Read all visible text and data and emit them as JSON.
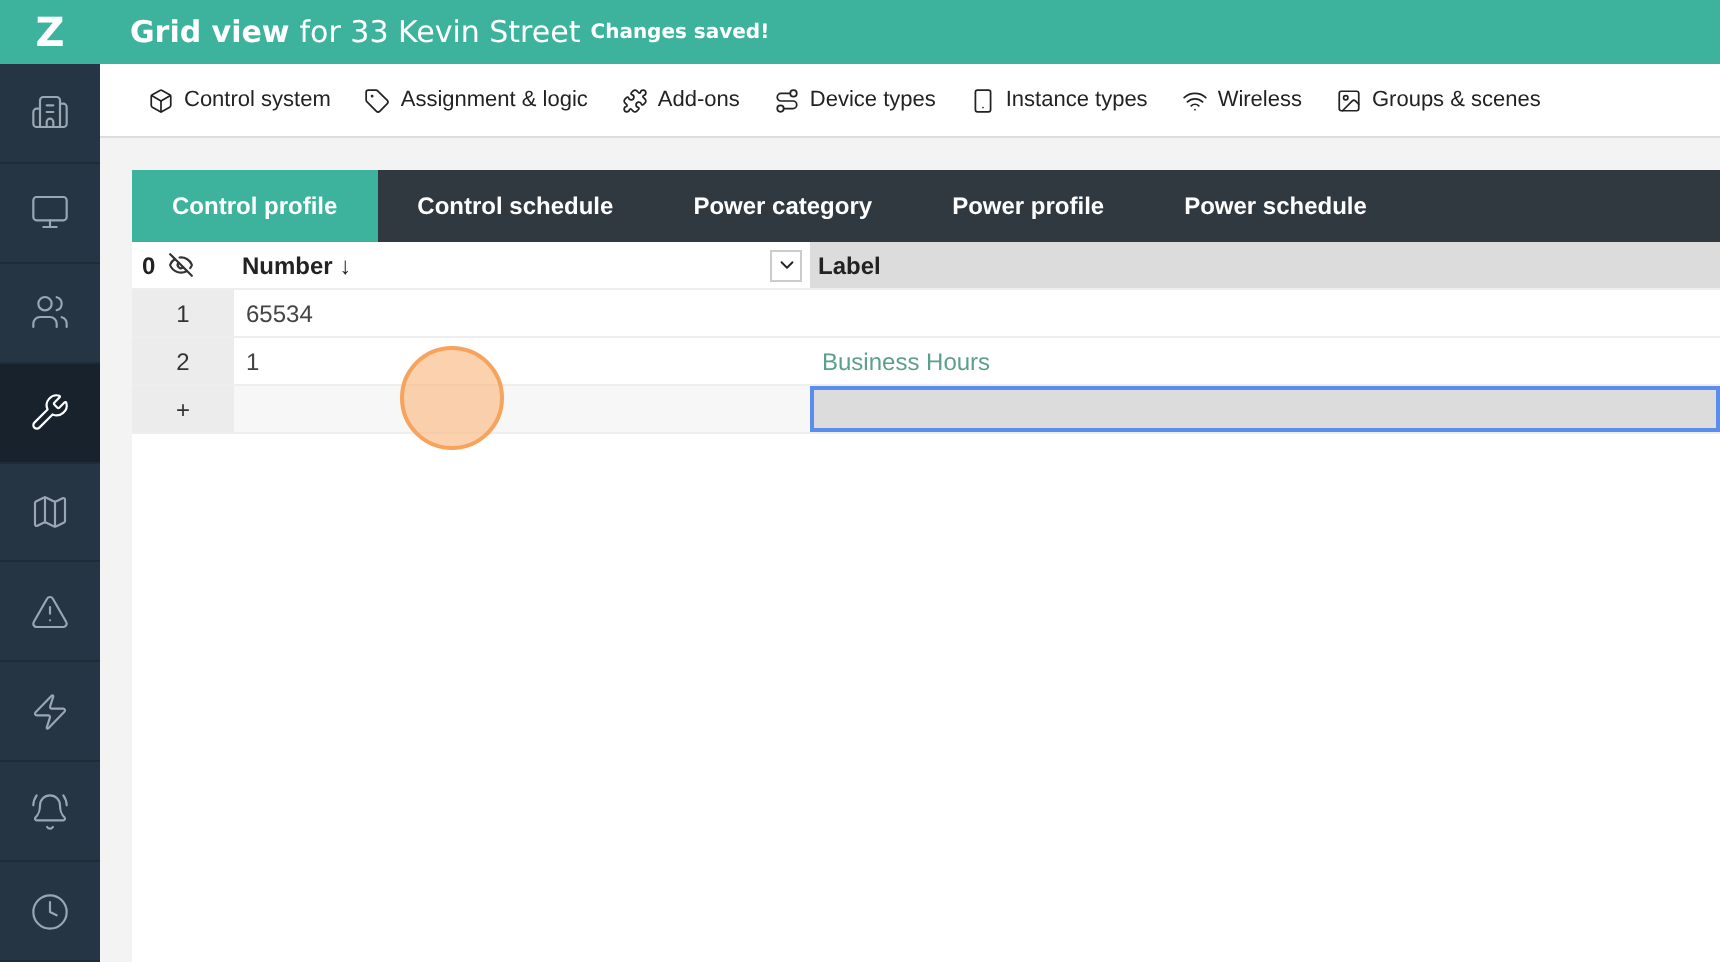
{
  "header": {
    "logo": "Z",
    "title": "Grid view",
    "subtitle": "for 33 Kevin Street",
    "status": "Changes saved!"
  },
  "sidebar": {
    "items": [
      {
        "selected": false
      },
      {
        "selected": false
      },
      {
        "selected": false
      },
      {
        "selected": true
      },
      {
        "selected": false
      },
      {
        "selected": false
      },
      {
        "selected": false
      },
      {
        "selected": false
      },
      {
        "selected": false
      }
    ]
  },
  "nav": [
    {
      "label": "Control system"
    },
    {
      "label": "Assignment & logic"
    },
    {
      "label": "Add-ons"
    },
    {
      "label": "Device types"
    },
    {
      "label": "Instance types"
    },
    {
      "label": "Wireless"
    },
    {
      "label": "Groups & scenes"
    }
  ],
  "tabs": [
    {
      "label": "Control profile",
      "selected": true
    },
    {
      "label": "Control schedule",
      "selected": false
    },
    {
      "label": "Power category",
      "selected": false
    },
    {
      "label": "Power profile",
      "selected": false
    },
    {
      "label": "Power schedule",
      "selected": false
    }
  ],
  "grid": {
    "hidden_count": "0",
    "columns": [
      {
        "label": "Number ↓",
        "selected": false
      },
      {
        "label": "Label",
        "selected": true
      }
    ],
    "rows": [
      {
        "index": "1",
        "cells": [
          {
            "text": "65534",
            "selected": false
          },
          {
            "text": "",
            "selected": false
          }
        ]
      },
      {
        "index": "2",
        "cells": [
          {
            "text": "1",
            "selected": false
          },
          {
            "text": "Business Hours",
            "selected": false,
            "kind": "link"
          }
        ]
      },
      {
        "index": "+",
        "cells": [
          {
            "text": "",
            "selected": false
          },
          {
            "text": "",
            "selected": true
          }
        ],
        "kind": "new"
      }
    ]
  },
  "click_indicator": true
}
